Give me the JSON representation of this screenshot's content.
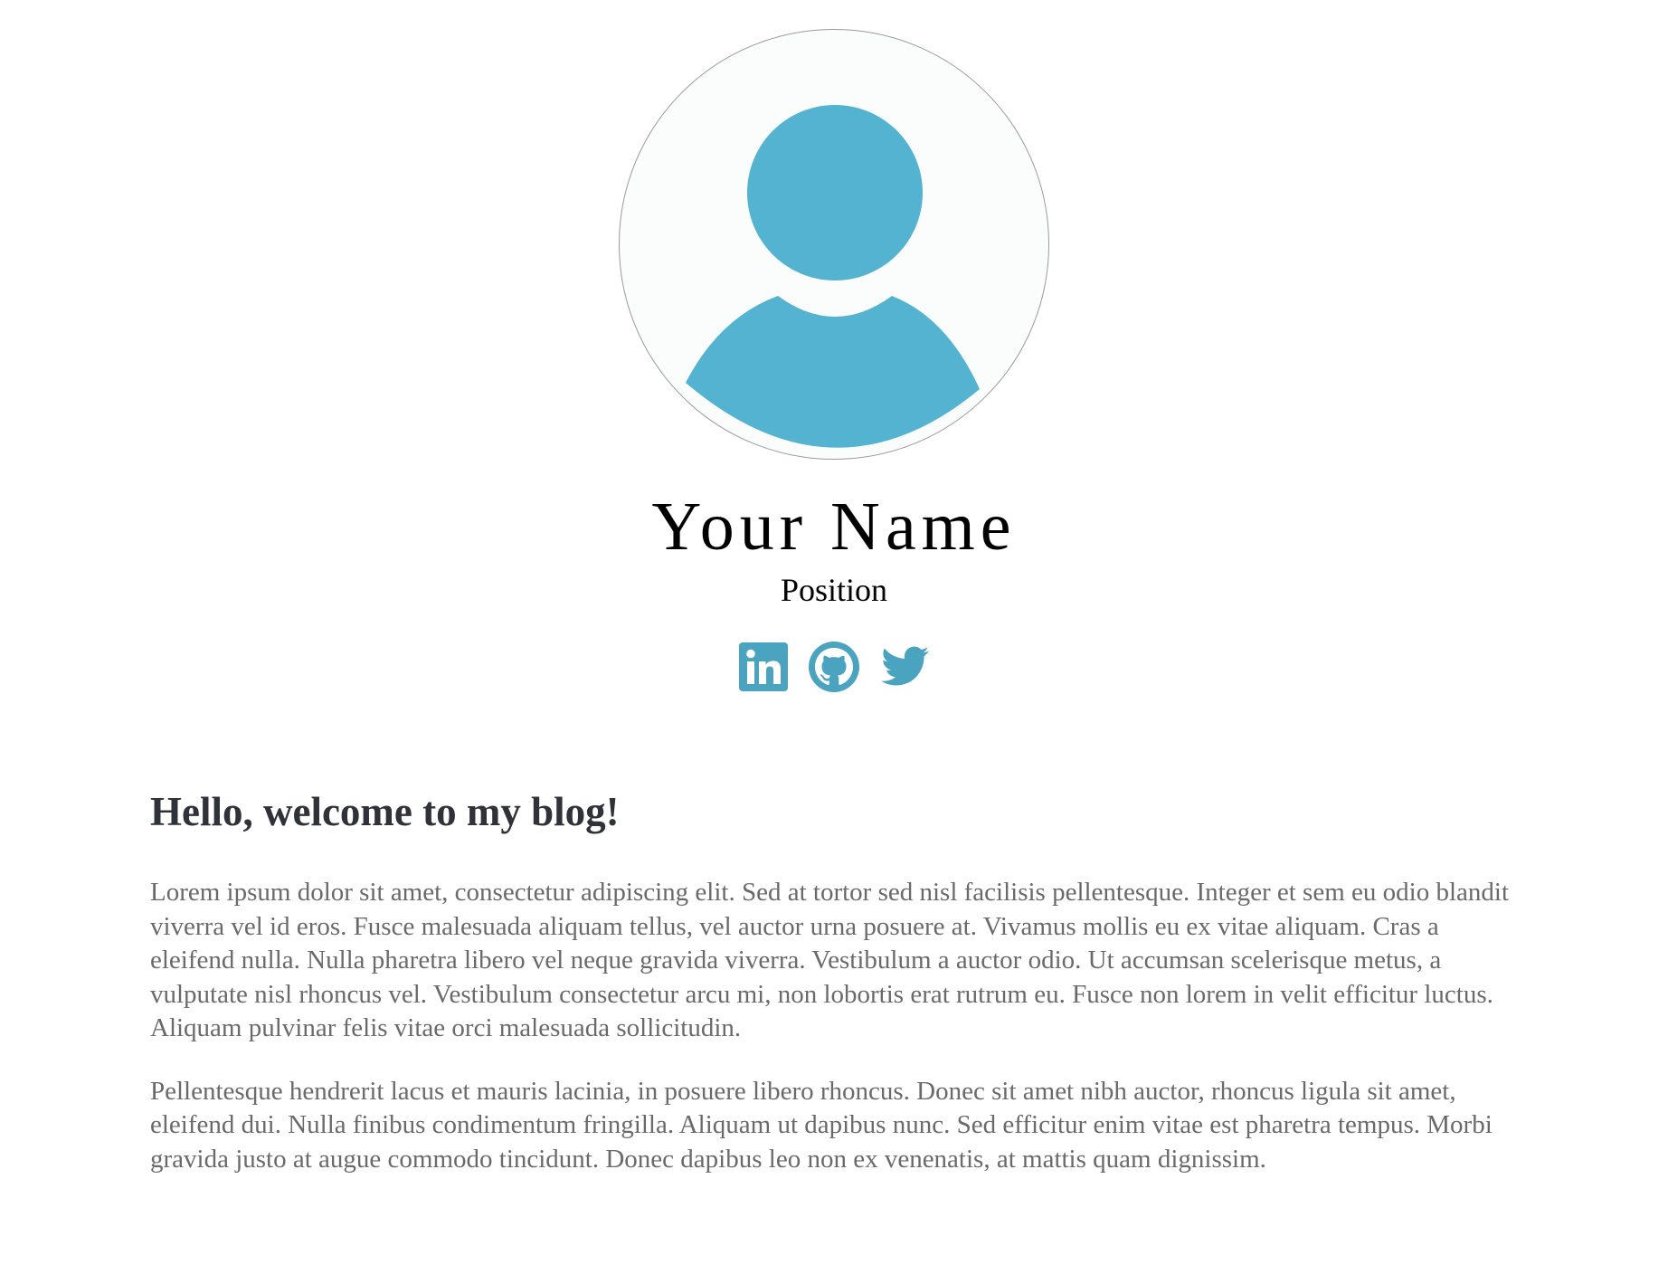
{
  "profile": {
    "name": "Your Name",
    "position": "Position",
    "avatar_icon": "user-avatar-icon",
    "avatar_color": "#53b3d0"
  },
  "socials": [
    {
      "icon": "linkedin-icon"
    },
    {
      "icon": "github-icon"
    },
    {
      "icon": "twitter-icon"
    }
  ],
  "colors": {
    "accent": "#4aa3bf",
    "heading": "#2f3238",
    "body_text": "#6a6a6a"
  },
  "blog": {
    "title": "Hello, welcome to my blog!",
    "paragraphs": [
      "Lorem ipsum dolor sit amet, consectetur adipiscing elit. Sed at tortor sed nisl facilisis pellentesque. Integer et sem eu odio blandit viverra vel id eros. Fusce malesuada aliquam tellus, vel auctor urna posuere at. Vivamus mollis eu ex vitae aliquam. Cras a eleifend nulla. Nulla pharetra libero vel neque gravida viverra. Vestibulum a auctor odio. Ut accumsan scelerisque metus, a vulputate nisl rhoncus vel. Vestibulum consectetur arcu mi, non lobortis erat rutrum eu. Fusce non lorem in velit efficitur luctus. Aliquam pulvinar felis vitae orci malesuada sollicitudin.",
      "Pellentesque hendrerit lacus et mauris lacinia, in posuere libero rhoncus. Donec sit amet nibh auctor, rhoncus ligula sit amet, eleifend dui. Nulla finibus condimentum fringilla. Aliquam ut dapibus nunc. Sed efficitur enim vitae est pharetra tempus. Morbi gravida justo at augue commodo tincidunt. Donec dapibus leo non ex venenatis, at mattis quam dignissim."
    ]
  }
}
